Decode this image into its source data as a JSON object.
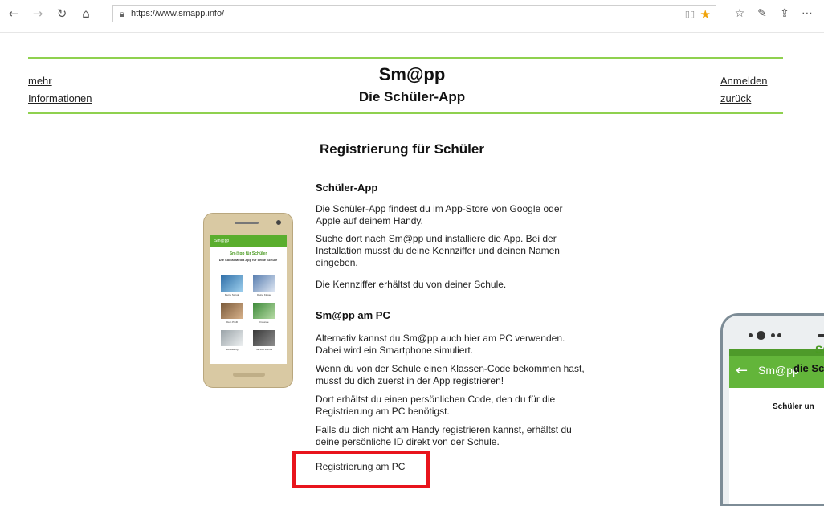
{
  "browser": {
    "url": "https://www.smapp.info/",
    "icons": [
      "back-icon",
      "forward-icon",
      "refresh-icon",
      "home-icon",
      "lock-icon",
      "reading-view-icon",
      "favorite-star-icon",
      "favorites-list-icon",
      "notes-icon",
      "share-icon",
      "more-icon"
    ]
  },
  "header": {
    "left_link_1": "mehr",
    "left_link_2": "Informationen",
    "title": "Sm@pp",
    "subtitle": "Die Schüler-App",
    "right_link_1": "Anmelden",
    "right_link_2": "zurück",
    "accent_color": "#8fd14f"
  },
  "main": {
    "heading": "Registrierung für Schüler",
    "section1": {
      "title": "Schüler-App",
      "p1": "Die Schüler-App findest du im App-Store von Google oder Apple auf deinem Handy.",
      "p2": "Suche dort nach Sm@pp und installiere die App. Bei der Installation musst du deine Kennziffer und deinen Namen eingeben.",
      "p3": "Die Kennziffer erhältst du von deiner Schule."
    },
    "section2": {
      "title": "Sm@pp am PC",
      "p1": "Alternativ kannst du Sm@pp auch hier am PC verwenden. Dabei wird ein Smartphone simuliert.",
      "p2": "Wenn du von der Schule einen Klassen-Code bekommen hast, musst du dich zuerst in der App registrieren!",
      "p3": "Dort erhältst du einen persönlichen Code, den du für die Registrierung am PC benötigst.",
      "p4": "Falls du dich nicht am Handy registrieren kannst, erhältst du deine persönliche ID direkt von der Schule."
    },
    "register_link": "Registrierung am PC",
    "highlight_color": "#e8141c"
  },
  "phone_small": {
    "bar_title": "Sm@pp",
    "app_title": "Sm@pp für Schüler",
    "app_sub": "Die Social Media App für deine Schule",
    "tiles": [
      "Meine Schule",
      "Deine Klasse",
      "Dein Profil",
      "Freunde",
      "Verwaltung",
      "Service & Infos"
    ]
  },
  "phone_large": {
    "bar_title": "Sm@pp",
    "heading": "Sm",
    "subheading": "die Sc",
    "line3": "Schüler un"
  }
}
